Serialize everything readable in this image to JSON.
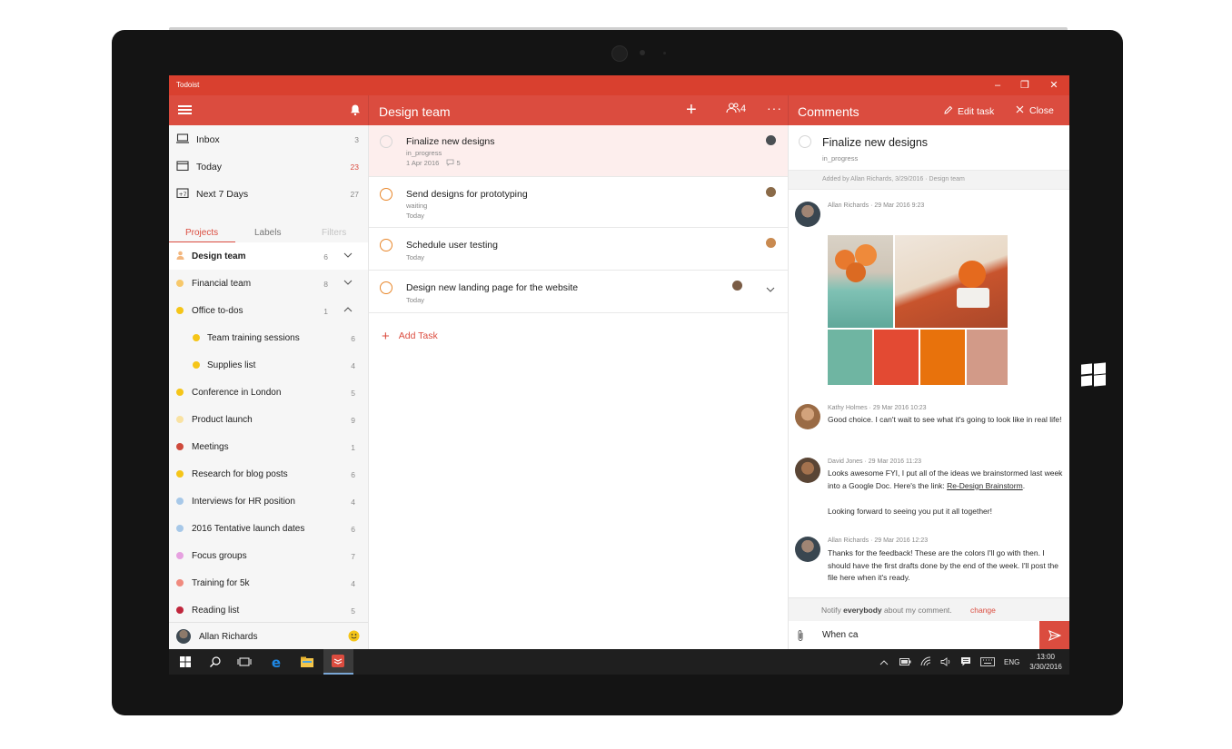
{
  "window": {
    "app_title": "Todoist",
    "controls": [
      "–",
      "❐",
      "✕"
    ]
  },
  "header": {
    "project_title": "Design team",
    "collaborator_count": "4",
    "comments_title": "Comments",
    "edit_task": "Edit task",
    "close": "Close"
  },
  "sidebar": {
    "fixed": [
      {
        "label": "Inbox",
        "count": "3"
      },
      {
        "label": "Today",
        "count": "23"
      },
      {
        "label": "Next 7 Days",
        "count": "27"
      }
    ],
    "tabs": [
      "Projects",
      "Labels",
      "Filters"
    ],
    "projects": [
      {
        "label": "Design team",
        "count": "6",
        "color": "#f3b77f"
      },
      {
        "label": "Financial team",
        "count": "8",
        "color": "#f7c86a"
      },
      {
        "label": "Office to-dos",
        "count": "1",
        "color": "#f5c518"
      },
      {
        "label": "Team training sessions",
        "count": "6",
        "color": "#f5c518"
      },
      {
        "label": "Supplies list",
        "count": "4",
        "color": "#f5c518"
      },
      {
        "label": "Conference in London",
        "count": "5",
        "color": "#f5c518"
      },
      {
        "label": "Product launch",
        "count": "9",
        "color": "#f9e2a2"
      },
      {
        "label": "Meetings",
        "count": "1",
        "color": "#cf4a3c"
      },
      {
        "label": "Research for blog posts",
        "count": "6",
        "color": "#f5c518"
      },
      {
        "label": "Interviews for HR position",
        "count": "4",
        "color": "#a7c8e8"
      },
      {
        "label": "2016 Tentative launch dates",
        "count": "6",
        "color": "#a7c8e8"
      },
      {
        "label": "Focus groups",
        "count": "7",
        "color": "#e6a1e0"
      },
      {
        "label": "Training for 5k",
        "count": "4",
        "color": "#f08a7e"
      },
      {
        "label": "Reading list",
        "count": "5",
        "color": "#c0263c"
      }
    ],
    "user_name": "Allan Richards"
  },
  "tasks": [
    {
      "name": "Finalize new designs",
      "status": "in_progress",
      "date": "1 Apr 2016",
      "comments": "5"
    },
    {
      "name": "Send designs for prototyping",
      "status": "waiting",
      "date": "Today"
    },
    {
      "name": "Schedule user testing",
      "date": "Today"
    },
    {
      "name": "Design new landing page for the website",
      "date": "Today"
    }
  ],
  "add_task": "Add Task",
  "comment_panel": {
    "task_title": "Finalize new designs",
    "task_status": "in_progress",
    "added_by": "Added by Allan Richards, 3/29/2016 · Design team",
    "comments": [
      {
        "author": "Allan Richards",
        "time": "29 Mar 2016 9:23"
      },
      {
        "author": "Kathy Holmes",
        "time": "29 Mar 2016 10:23",
        "text": "Good choice. I can't wait to see what it's going to look like in real life!"
      },
      {
        "author": "David Jones",
        "time": "29 Mar 2016 11:23",
        "text_before": "Looks awesome FYI, I put all of the ideas we brainstormed last week into a Google Doc. Here's the link: ",
        "link": "Re-Design Brainstorm",
        "text_after": ".",
        "text2": "Looking forward to seeing you put it all together!"
      },
      {
        "author": "Allan Richards",
        "time": "29 Mar 2016 12:23",
        "text": "Thanks for the feedback! These are the colors I'll go with then. I should have the first drafts done by the end of the week. I'll post the file here when it's ready."
      }
    ],
    "swatches": [
      "#6fb5a2",
      "#e34a33",
      "#e8720c",
      "#d29a88"
    ],
    "notify_pre": "Notify",
    "notify_bold": "everybody",
    "notify_post": "about my comment.",
    "notify_change": "change",
    "input_value": "When ca"
  },
  "taskbar": {
    "lang": "ENG",
    "time": "13:00",
    "date": "3/30/2016"
  },
  "colors": {
    "brand": "#db4c3f",
    "titlebar": "#d9402f",
    "task_circle": "#e8862a"
  }
}
